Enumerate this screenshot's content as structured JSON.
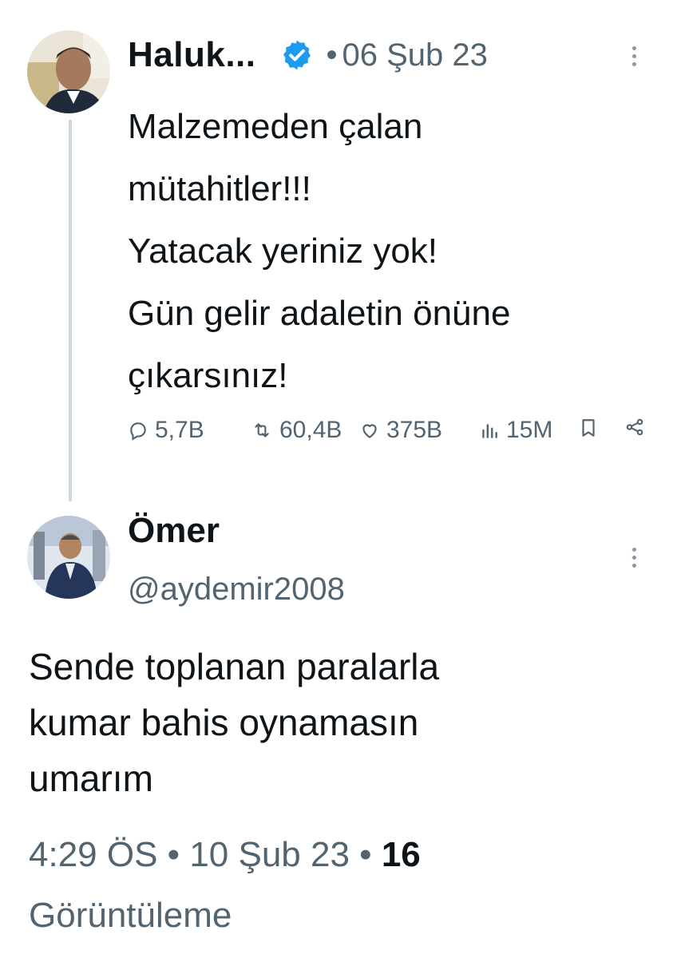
{
  "original_tweet": {
    "author_name": "Haluk...",
    "separator": "•",
    "date": "06 Şub 23",
    "lines": [
      "Malzemeden çalan",
      "mütahitler!!!",
      "Yatacak yeriniz yok!",
      "Gün gelir adaletin önüne",
      "çıkarsınız!"
    ],
    "stats": {
      "replies": "5,7B",
      "retweets": "60,4B",
      "likes": "375B",
      "views": "15M"
    }
  },
  "reply_tweet": {
    "author_name": "Ömer",
    "handle": "@aydemir2008",
    "lines": [
      "Sende toplanan paralarla",
      "kumar bahis oynamasın",
      "umarım"
    ],
    "time": "4:29 ÖS",
    "separator": "•",
    "date": "10 Şub 23",
    "view_count": "16",
    "view_label": "Görüntüleme"
  },
  "colors": {
    "text": "#0f1419",
    "secondary": "#536471",
    "verified": "#1d9bf0",
    "thread_line": "#cfd9de"
  },
  "icons": [
    "verified-badge-icon",
    "more-options-icon",
    "reply-icon",
    "retweet-icon",
    "like-icon",
    "views-icon",
    "bookmark-icon",
    "share-icon"
  ]
}
